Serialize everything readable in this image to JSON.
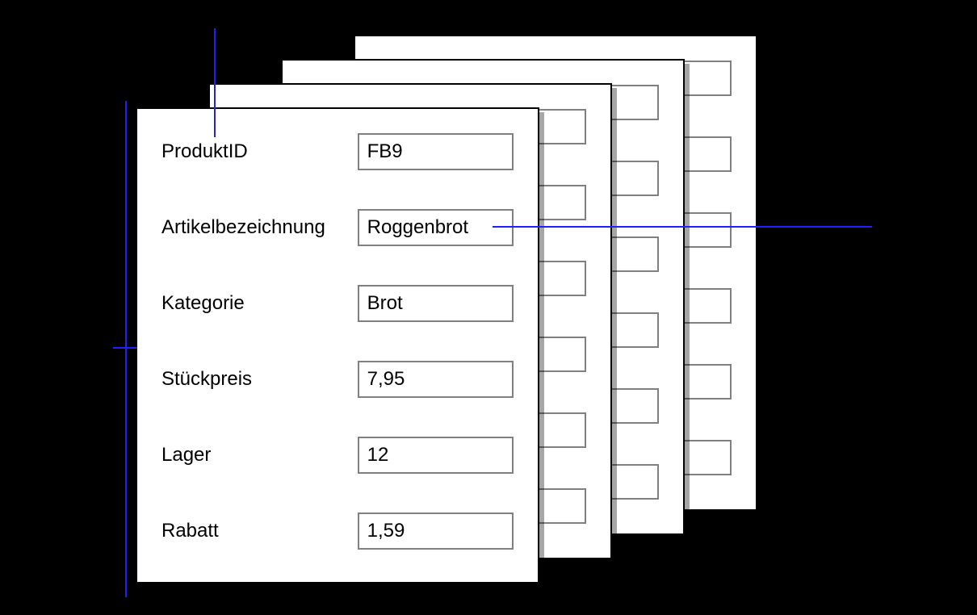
{
  "colors": {
    "highlight": "#2020ff",
    "inputBorder": "#808080"
  },
  "form": {
    "fields": [
      {
        "label": "ProduktID",
        "value": "FB9"
      },
      {
        "label": "Artikelbezeichnung",
        "value": "Roggenbrot"
      },
      {
        "label": "Kategorie",
        "value": "Brot"
      },
      {
        "label": "Stückpreis",
        "value": "7,95"
      },
      {
        "label": "Lager",
        "value": "12"
      },
      {
        "label": "Rabatt",
        "value": "1,59"
      }
    ]
  },
  "stacked_cards": 4
}
